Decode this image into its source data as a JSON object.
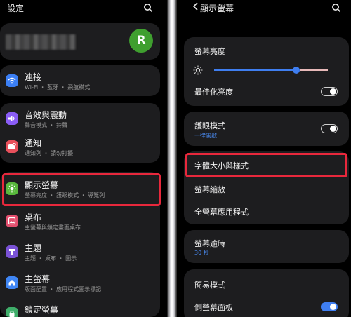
{
  "left": {
    "title": "設定",
    "profile": {
      "avatar_letter": "R"
    },
    "items": [
      {
        "label": "連接",
        "sub": "Wi-Fi ・ 藍牙 ・ 飛航模式",
        "icon": "wifi-icon",
        "color": "#3b7ff5"
      },
      {
        "label": "音效與震動",
        "sub": "聲音模式 ・ 鈴聲",
        "icon": "sound-icon",
        "color": "#8a5cf6"
      },
      {
        "label": "通知",
        "sub": "通知列 ・ 請勿打擾",
        "icon": "notification-icon",
        "color": "#e8505b"
      },
      {
        "label": "顯示螢幕",
        "sub": "螢幕亮度 ・ 護眼模式 ・ 導覽列",
        "icon": "brightness-icon",
        "color": "#58b83c"
      },
      {
        "label": "桌布",
        "sub": "主螢幕與鎖定畫面桌布",
        "icon": "wallpaper-icon",
        "color": "#e34f6e"
      },
      {
        "label": "主題",
        "sub": "主題 ・ 桌布 ・ 圖示",
        "icon": "theme-icon",
        "color": "#7a52d6"
      },
      {
        "label": "主螢幕",
        "sub": "版面配置 ・ 應用程式圖示標記",
        "icon": "home-icon",
        "color": "#3f86f5"
      },
      {
        "label": "鎖定螢幕",
        "sub": "",
        "icon": "lock-icon",
        "color": "#3fae6a"
      }
    ]
  },
  "right": {
    "title": "顯示螢幕",
    "brightness_label": "螢幕亮度",
    "brightness_level": 0.72,
    "adaptive_label": "最佳化亮度",
    "adaptive_on": false,
    "eye_label": "護眼模式",
    "eye_sub": "一律開啟",
    "eye_on": false,
    "font_label": "字體大小與樣式",
    "zoom_label": "螢幕縮放",
    "fullscreen_label": "全螢幕應用程式",
    "timeout_label": "螢幕逾時",
    "timeout_value": "30 秒",
    "easy_label": "簡易模式",
    "edge_label": "側螢幕面板",
    "edge_on": true
  },
  "colors": {
    "highlight": "#e8283c",
    "accent": "#3f7ef0",
    "avatar": "#3f9f2f"
  }
}
